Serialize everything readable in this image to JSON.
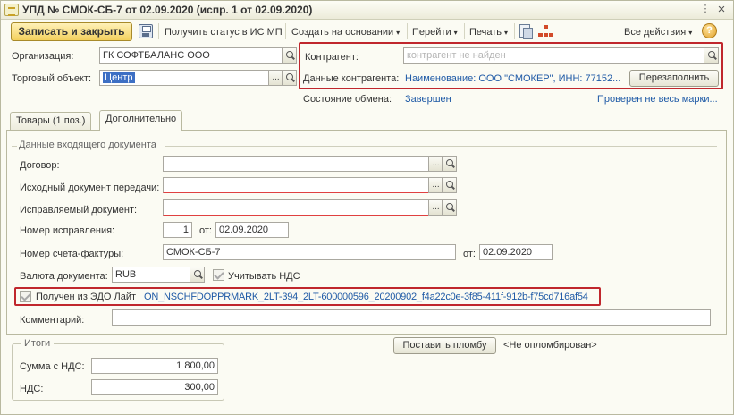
{
  "window": {
    "title": "УПД № СМОК-СБ-7 от 02.09.2020 (испр. 1 от 02.09.2020)",
    "menu_glyph": "⋮",
    "close_glyph": "×"
  },
  "toolbar": {
    "save_close_label": "Записать и закрыть",
    "get_status_label": "Получить статус в ИС МП",
    "create_based_label": "Создать на основании",
    "goto_label": "Перейти",
    "print_label": "Печать",
    "all_actions_label": "Все действия",
    "help_glyph": "?",
    "caret": "▾"
  },
  "header": {
    "organization_label": "Организация:",
    "organization_value": "ГК СОФТБАЛАНС ООО",
    "trade_object_label": "Торговый объект:",
    "trade_object_value": "Центр",
    "counterparty_label": "Контрагент:",
    "counterparty_placeholder": "контрагент не найден",
    "counterparty_data_label": "Данные контрагента:",
    "counterparty_data_value": "Наименование: ООО \"СМОКЕР\", ИНН: 77152...",
    "refill_button": "Перезаполнить",
    "exchange_state_label": "Состояние обмена:",
    "exchange_state_value": "Завершен",
    "marks_check_link": "Проверен не весь марки..."
  },
  "tabs": [
    {
      "label": "Товары (1 поз.)"
    },
    {
      "label": "Дополнительно"
    }
  ],
  "incoming": {
    "group_title": "Данные входящего документа",
    "contract_label": "Договор:",
    "contract_value": "",
    "source_doc_label": "Исходный документ передачи:",
    "source_doc_value": "",
    "corrected_doc_label": "Исправляемый документ:",
    "corrected_doc_value": "",
    "correction_no_label": "Номер исправления:",
    "correction_no_value": "1",
    "from_label": "от:",
    "correction_date": "02.09.2020",
    "invoice_no_label": "Номер счета-фактуры:",
    "invoice_no_value": "СМОК-СБ-7",
    "invoice_date": "02.09.2020",
    "currency_label": "Валюта документа:",
    "currency_value": "RUB",
    "vat_checkbox_label": "Учитывать НДС",
    "edo_checkbox_label": "Получен из ЭДО Лайт",
    "edo_id": "ON_NSCHFDOPPRMARK_2LT-394_2LT-600000596_20200902_f4a22c0e-3f85-411f-912b-f75cd716af54",
    "comment_label": "Комментарий:",
    "comment_value": ""
  },
  "totals": {
    "group_title": "Итоги",
    "sum_label": "Сумма с НДС:",
    "sum_value": "1 800,00",
    "vat_label": "НДС:",
    "vat_value": "300,00",
    "seal_button": "Поставить пломбу",
    "seal_state": "<Не опломбирован>"
  },
  "buttons": {
    "ellipsis": "...",
    "x_glyph": "×"
  }
}
